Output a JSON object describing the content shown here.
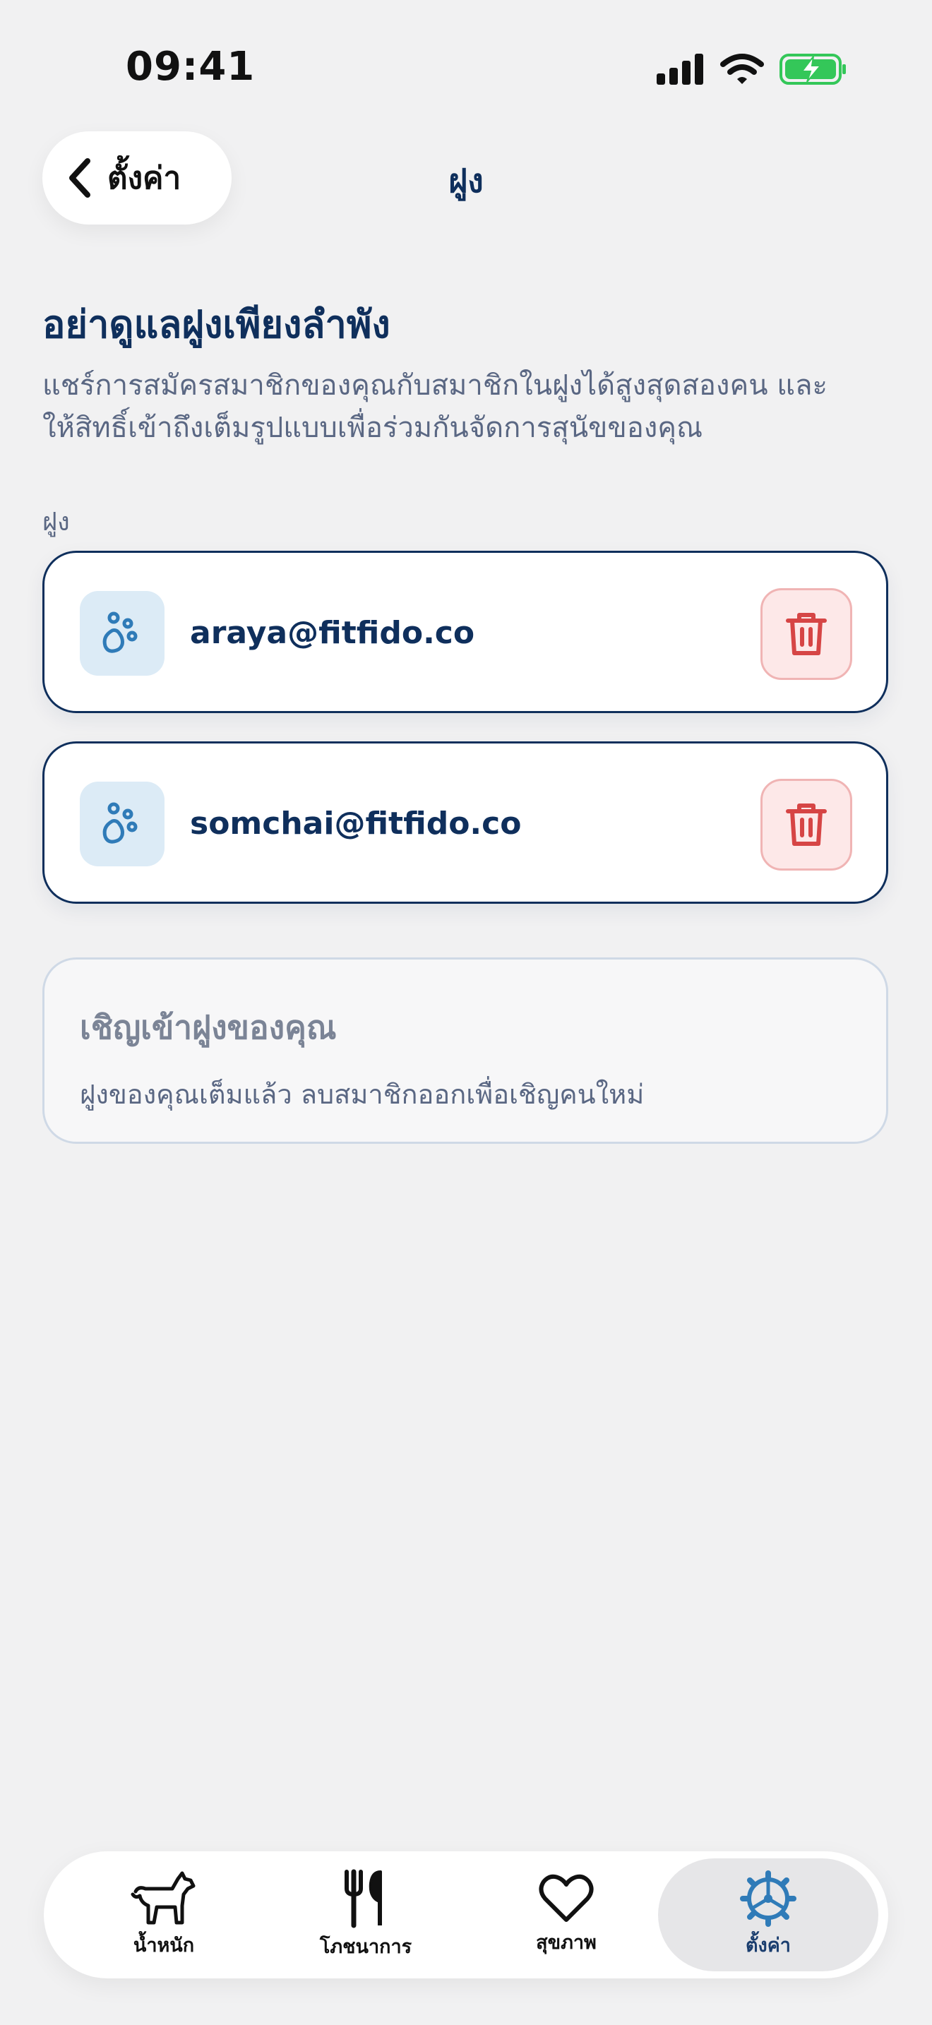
{
  "status_bar": {
    "time": "09:41"
  },
  "nav": {
    "back_label": "ตั้งค่า",
    "title": "ฝูง"
  },
  "intro": {
    "heading": "อย่าดูแลฝูงเพียงลำพัง",
    "line1": "แชร์การสมัครสมาชิกของคุณกับสมาชิกในฝูงได้สูงสุดสองคน และ",
    "line2": "ให้สิทธิ์เข้าถึงเต็มรูปแบบเพื่อร่วมกันจัดการสุนัขของคุณ"
  },
  "members": {
    "section_label": "ฝูง",
    "items": [
      {
        "email": "araya@fitfido.co"
      },
      {
        "email": "somchai@fitfido.co"
      }
    ]
  },
  "invite": {
    "title": "เชิญเข้าฝูงของคุณ",
    "note": "ฝูงของคุณเต็มแล้ว ลบสมาชิกออกเพื่อเชิญคนใหม่"
  },
  "tabs": [
    {
      "label": "น้ำหนัก",
      "icon": "dog-icon"
    },
    {
      "label": "โภชนาการ",
      "icon": "fork-knife-icon"
    },
    {
      "label": "สุขภาพ",
      "icon": "heart-icon"
    },
    {
      "label": "ตั้งค่า",
      "icon": "gear-icon",
      "active": true
    }
  ],
  "colors": {
    "accent": "#0f2f5c",
    "danger": "#d64545",
    "danger_bg": "#fde8e8",
    "battery": "#34c759",
    "avatar_bg": "#dcebf6",
    "active_tab_icon": "#2f7bb8"
  }
}
